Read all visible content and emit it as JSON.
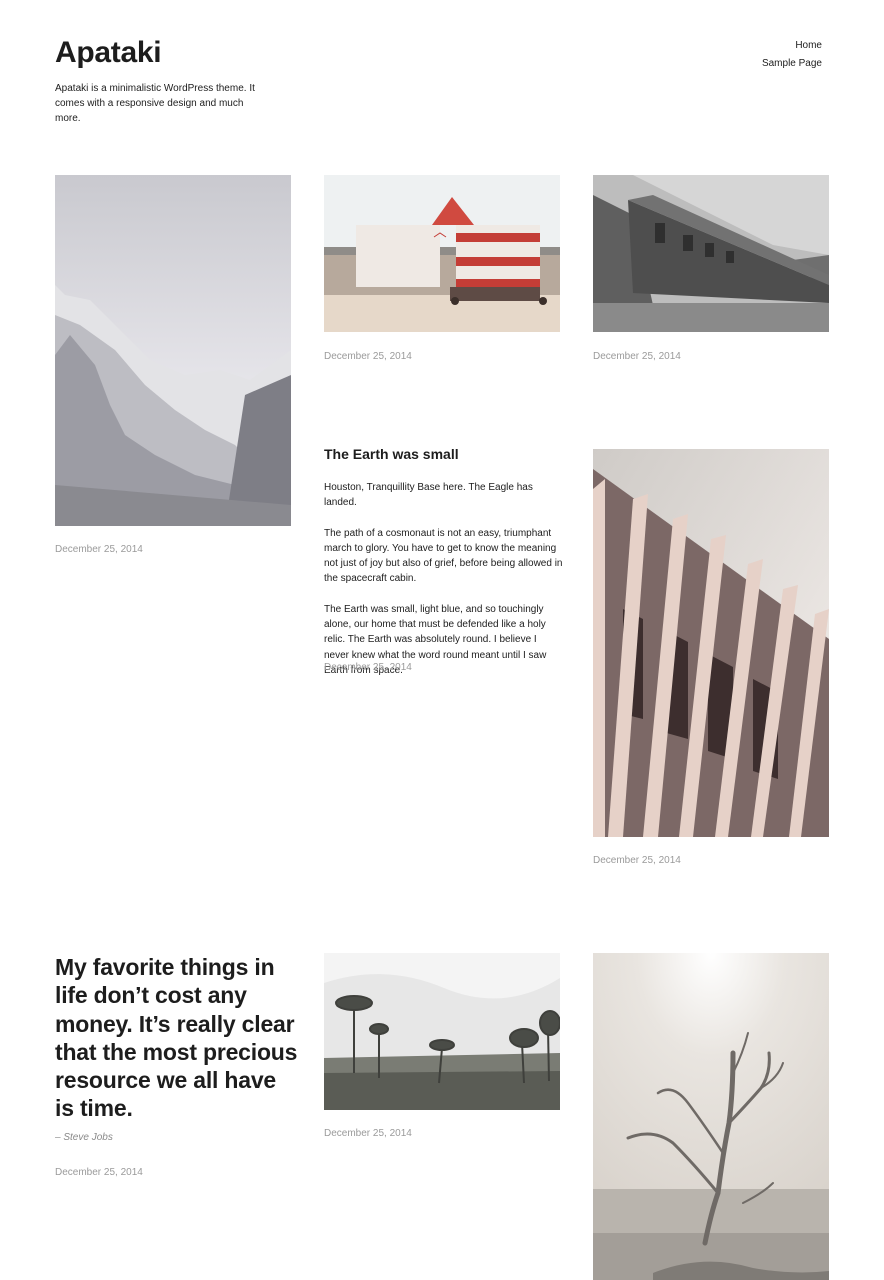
{
  "site": {
    "title": "Apataki",
    "description": "Apataki is a minimalistic WordPress theme. It comes with a responsive design and much more."
  },
  "nav": {
    "items": [
      "Home",
      "Sample Page"
    ]
  },
  "posts": [
    {
      "type": "image",
      "image": "snowy-mountain",
      "date": "December 25, 2014"
    },
    {
      "type": "image",
      "image": "striped-beach-hut",
      "date": "December 25, 2014"
    },
    {
      "type": "image",
      "image": "train-carriage",
      "date": "December 25, 2014"
    },
    {
      "type": "text",
      "title": "The Earth was small",
      "paragraphs": [
        "Houston, Tranquillity Base here. The Eagle has landed.",
        "The path of a cosmonaut is not an easy, triumphant march to glory. You have to get to know the meaning not just of joy but also of grief, before being allowed in the spacecraft cabin.",
        "The Earth was small, light blue, and so touchingly alone, our home that must be defended like a holy relic. The Earth was absolutely round. I believe I never knew what the word round meant until I saw Earth from space."
      ],
      "date": "December 25, 2014"
    },
    {
      "type": "image",
      "image": "building-facade",
      "date": "December 25, 2014"
    },
    {
      "type": "quote",
      "quote": "My favorite things in life don’t cost any money. It’s really clear that the most precious resource we all have is time.",
      "author": "– Steve Jobs",
      "date": "December 25, 2014"
    },
    {
      "type": "image",
      "image": "trees-landscape",
      "date": "December 25, 2014"
    },
    {
      "type": "image",
      "image": "bare-tree-desert"
    }
  ],
  "colors": {
    "text": "#1d1d1d",
    "meta": "#9a9a9a",
    "hut_red": "#c0403a"
  }
}
